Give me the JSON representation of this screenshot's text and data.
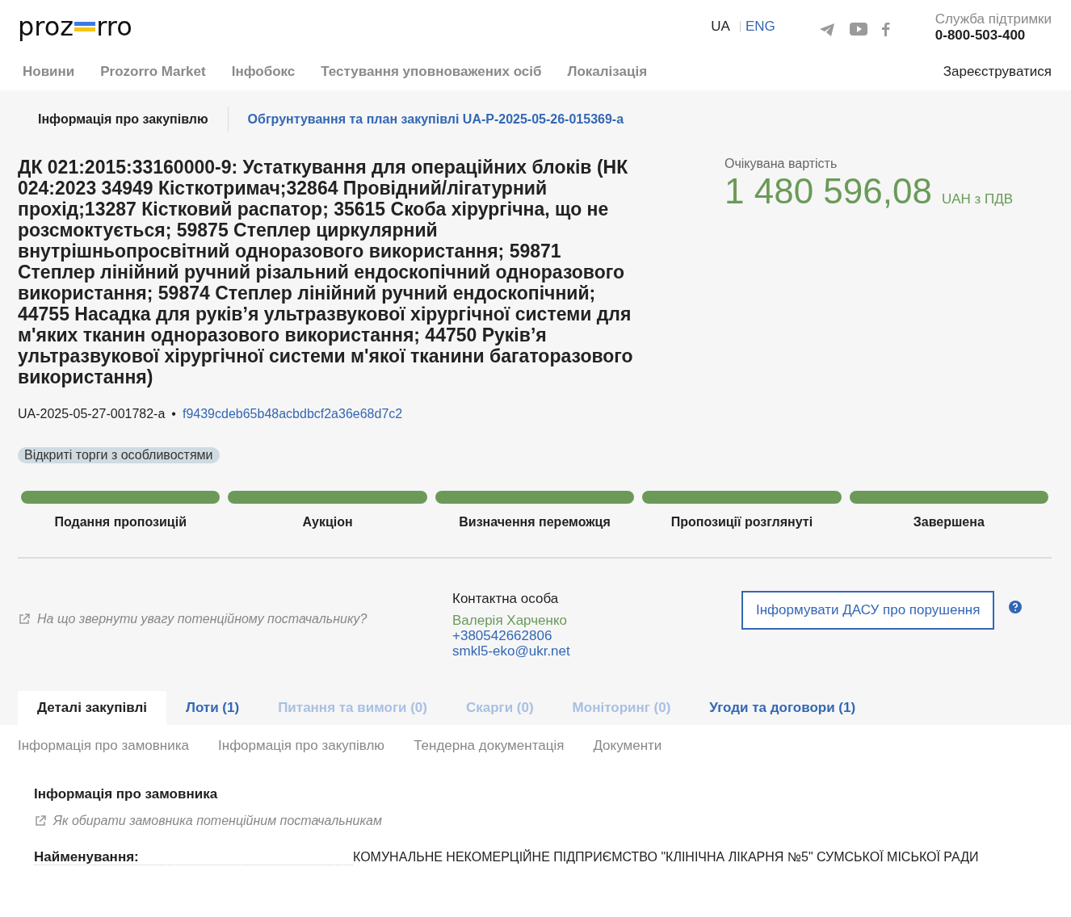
{
  "header": {
    "logo": {
      "left": "proz",
      "right": "rro"
    },
    "languages": [
      {
        "label": "UA",
        "selected": true
      },
      {
        "label": "ENG",
        "selected": false
      }
    ],
    "support": {
      "label": "Служба підтримки",
      "phone": "0-800-503-400"
    }
  },
  "nav": {
    "items": [
      "Новини",
      "Prozorro Market",
      "Інфобокс",
      "Тестування уповноважених осіб",
      "Локалізація"
    ],
    "register": "Зареєструватися"
  },
  "subtabs": [
    {
      "label": "Інформація про закупівлю",
      "selected": true
    },
    {
      "label": "Обгрунтування та план закупівлі UA-P-2025-05-26-015369-a",
      "selected": false
    }
  ],
  "title": "ДК 021:2015:33160000-9: Устаткування для операційних блоків (НК 024:2023 34949 Кісткотримач;32864 Провідний/лігатурний прохід;13287 Кістковий распатор; 35615 Скоба хірургічна, що не розсмоктується; 59875 Степлер циркулярний внутрішньопросвітний одноразового використання; 59871 Степлер лінійний ручний різальний ендоскопічний одноразового використання; 59874 Степлер лінійний ручний ендоскопічний; 44755 Насадка для руків’я ультразвукової хірургічної системи для м'яких тканин одноразового використання; 44750 Руків’я ультразвукової хірургічної системи м'якої тканини багаторазового використання)",
  "price": {
    "label": "Очікувана вартість",
    "amount": "1 480 596,08",
    "currency": "UAH з ПДВ"
  },
  "tender_id": "UA-2025-05-27-001782-a",
  "separator": "•",
  "hash": "f9439cdeb65b48acbdbcf2a36e68d7c2",
  "procedure": "Відкриті торги з особливостями",
  "stages": [
    {
      "label": "Подання пропозицій",
      "done": true
    },
    {
      "label": "Аукціон",
      "done": true
    },
    {
      "label": "Визначення переможця",
      "done": true
    },
    {
      "label": "Пропозиції розглянуті",
      "done": true
    },
    {
      "label": "Завершена",
      "done": true
    }
  ],
  "hint_link": "На що звернути увагу потенційному постачальнику?",
  "contact": {
    "label": "Контактна особа",
    "name": "Валерія Харченко",
    "phone": "+380542662806",
    "email": "smkl5-eko@ukr.net"
  },
  "report_button": "Інформувати ДАСУ про порушення",
  "tabs": [
    {
      "label": "Деталі закупівлі",
      "selected": true,
      "disabled": false
    },
    {
      "label": "Лоти (1)",
      "selected": false,
      "disabled": false
    },
    {
      "label": "Питання та вимоги (0)",
      "selected": false,
      "disabled": true
    },
    {
      "label": "Скарги (0)",
      "selected": false,
      "disabled": true
    },
    {
      "label": "Моніторинг (0)",
      "selected": false,
      "disabled": true
    },
    {
      "label": "Угоди та договори (1)",
      "selected": false,
      "disabled": false
    }
  ],
  "section_links": [
    "Інформація про замовника",
    "Інформація про закупівлю",
    "Тендерна документація",
    "Документи"
  ],
  "customer": {
    "heading": "Інформація про замовника",
    "hint_link": "Як обирати замовника потенційним постачальникам",
    "fields": [
      {
        "label": "Найменування:",
        "value": "КОМУНАЛЬНЕ НЕКОМЕРЦІЙНЕ ПІДПРИЄМСТВО \"КЛІНІЧНА ЛІКАРНЯ №5\" СУМСЬКОЇ МІСЬКОЇ РАДИ"
      }
    ]
  }
}
